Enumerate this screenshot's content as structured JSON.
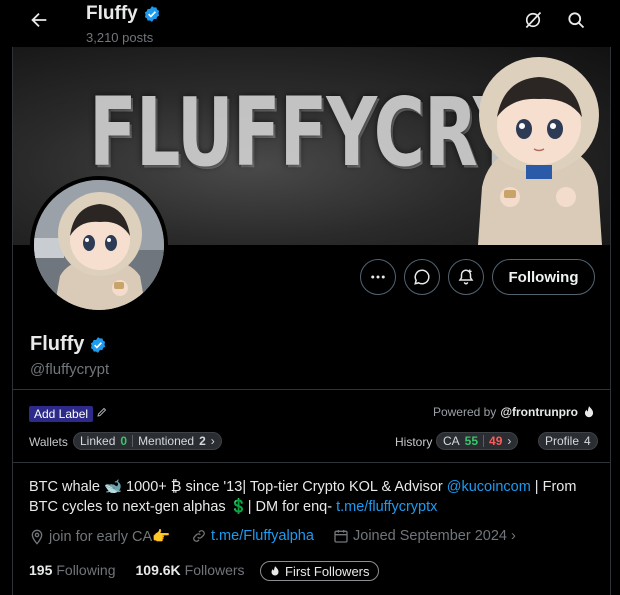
{
  "header": {
    "name": "Fluffy",
    "posts": "3,210 posts"
  },
  "banner": {
    "text": "FLUFFYCRYP"
  },
  "actions": {
    "follow_label": "Following"
  },
  "profile": {
    "name": "Fluffy",
    "handle": "@fluffycrypt"
  },
  "extension": {
    "add_label": "Add Label",
    "powered_prefix": "Powered by",
    "powered_name": "@frontrunpro",
    "wallets_label": "Wallets",
    "linked_label": "Linked",
    "linked_count": "0",
    "mentioned_label": "Mentioned",
    "mentioned_count": "2",
    "history_label": "History",
    "ca_label": "CA",
    "ca_green": "55",
    "ca_red": "49",
    "profile_label": "Profile",
    "profile_count": "4"
  },
  "bio": {
    "part1": "BTC whale 🐋 1000+ ₿ since '13| Top-tier Crypto KOL & Advisor ",
    "link1": "@kucoincom",
    "part2": " | From BTC cycles to next-gen alphas 💲| DM for enq- ",
    "link2": "t.me/fluffycryptx"
  },
  "meta": {
    "location": "join for early CA👉",
    "website": "t.me/Fluffyalpha",
    "joined": "Joined September 2024"
  },
  "stats": {
    "following_count": "195",
    "following_label": "Following",
    "followers_count": "109.6K",
    "followers_label": "Followers",
    "first_followers": "First Followers"
  },
  "colors": {
    "accent": "#1d9bf0",
    "verified": "#1d9bf0",
    "green": "#3cc36b",
    "red": "#ff5a5a"
  }
}
